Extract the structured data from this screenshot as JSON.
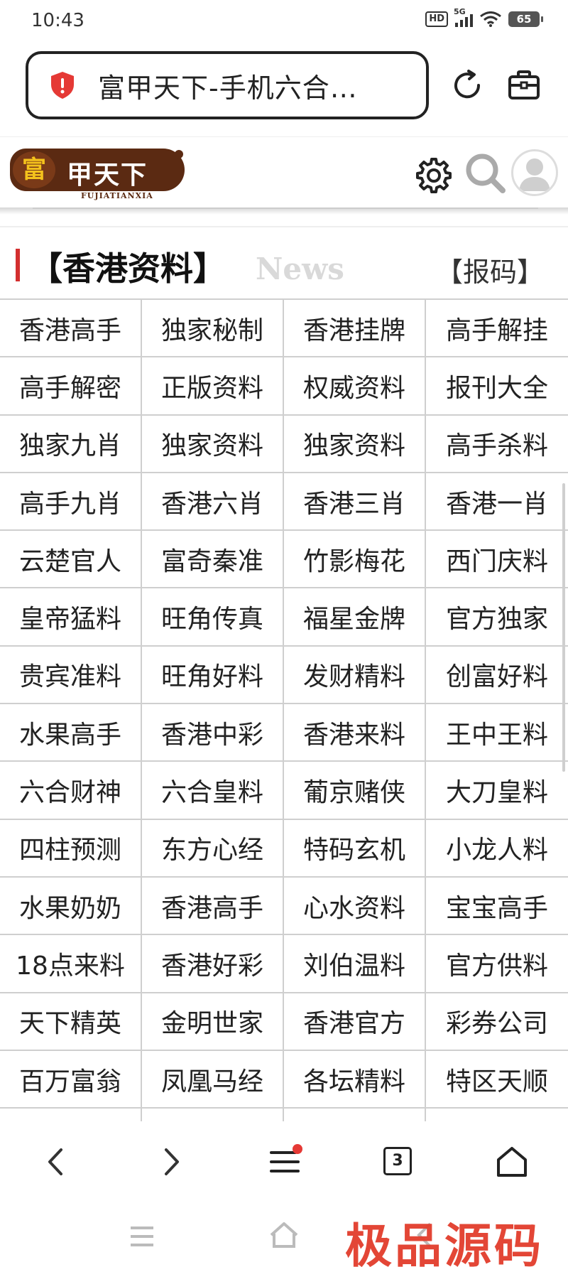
{
  "status_bar": {
    "time": "10:43",
    "hd": "HD",
    "network": "5G",
    "battery": "65"
  },
  "browser": {
    "url_title": "富甲天下-手机六合…",
    "tab_count": "3"
  },
  "site": {
    "logo_main": "甲天下",
    "logo_fu": "富",
    "logo_sub": "FUJIATIANXIA"
  },
  "section": {
    "title": "【香港资料】",
    "subtitle": "News",
    "report_link": "【报码】"
  },
  "grid_items": [
    "香港高手",
    "独家秘制",
    "香港挂牌",
    "高手解挂",
    "高手解密",
    "正版资料",
    "权威资料",
    "报刊大全",
    "独家九肖",
    "独家资料",
    "独家资料",
    "高手杀料",
    "高手九肖",
    "香港六肖",
    "香港三肖",
    "香港一肖",
    "云楚官人",
    "富奇秦准",
    "竹影梅花",
    "西门庆料",
    "皇帝猛料",
    "旺角传真",
    "福星金牌",
    "官方独家",
    "贵宾准料",
    "旺角好料",
    "发财精料",
    "创富好料",
    "水果高手",
    "香港中彩",
    "香港来料",
    "王中王料",
    "六合财神",
    "六合皇料",
    "葡京赌侠",
    "大刀皇料",
    "四柱预测",
    "东方心经",
    "特码玄机",
    "小龙人料",
    "水果奶奶",
    "香港高手",
    "心水资料",
    "宝宝高手",
    "18点来料",
    "香港好彩",
    "刘伯温料",
    "官方供料",
    "天下精英",
    "金明世家",
    "香港官方",
    "彩券公司",
    "百万富翁",
    "凤凰马经",
    "各坛精料",
    "特区天顺",
    "",
    "",
    "",
    ""
  ],
  "watermark": "极品源码",
  "colors": {
    "accent_red": "#d32f2f",
    "logo_brown": "#5b2a12",
    "logo_gold": "#f4c21c",
    "grid_border": "#cfcfcf",
    "news_gray": "#d9d9d9"
  }
}
